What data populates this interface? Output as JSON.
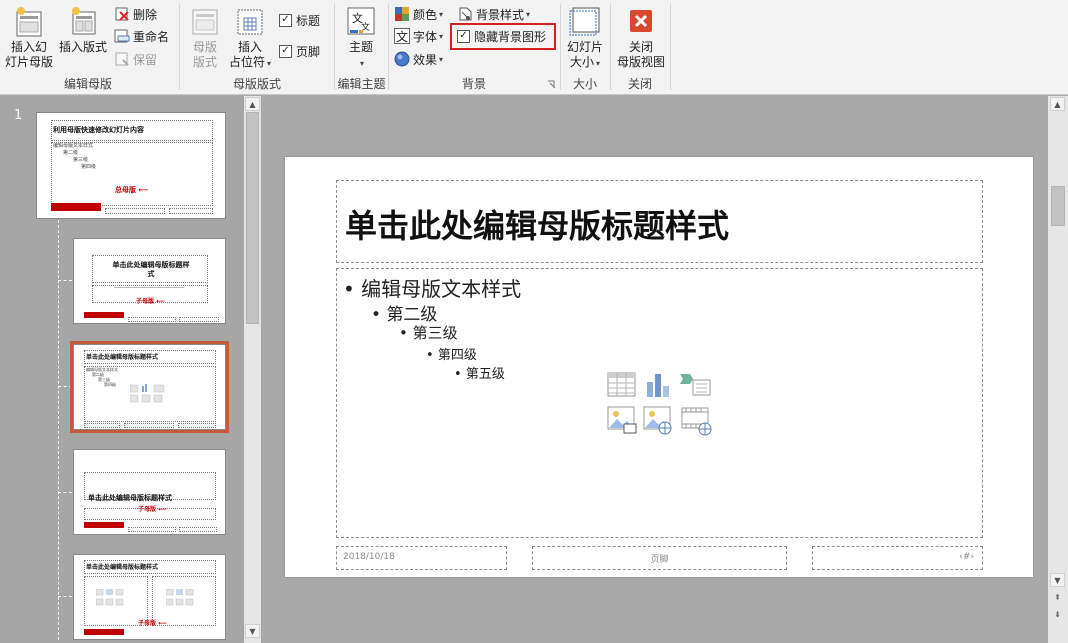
{
  "ribbon": {
    "groups": {
      "edit_master": {
        "label": "编辑母版",
        "insert_slide_master": "插入幻\n灯片母版",
        "insert_layout": "插入版式",
        "delete": "删除",
        "rename": "重命名",
        "preserve": "保留"
      },
      "master_layout": {
        "label": "母版版式",
        "master_layout_btn": "母版\n版式",
        "insert_placeholder": "插入\n占位符",
        "title_chk": "标题",
        "footer_chk": "页脚"
      },
      "edit_theme": {
        "label": "编辑主题",
        "themes": "主题"
      },
      "background": {
        "label": "背景",
        "colors": "颜色",
        "fonts": "字体",
        "effects": "效果",
        "background_styles": "背景样式",
        "hide_background_graphics": "隐藏背景图形"
      },
      "size": {
        "label": "大小",
        "slide_size": "幻灯片\n大小"
      },
      "close": {
        "label": "关闭",
        "close_master_view": "关闭\n母版视图"
      }
    }
  },
  "thumbnails": {
    "slide_number": "1",
    "master_title": "利用母版快速修改幻灯片内容",
    "master_body": [
      "编辑母版文本样式",
      "第二级",
      "第三级",
      "第四级",
      "第五级"
    ],
    "master_note": "总母版",
    "layout_title": "单击此处编辑母版标题样式",
    "layout_title_2": "单击此处编辑母版标题样",
    "layout_title_2b": "式",
    "sub_note": "子母版",
    "section_title": "单击此处编辑母版标题样式"
  },
  "slide": {
    "title": "单击此处编辑母版标题样式",
    "bullets": [
      "编辑母版文本样式",
      "第二级",
      "第三级",
      "第四级",
      "第五级"
    ],
    "footer_date": "2018/10/18",
    "footer_center": "页脚",
    "footer_number": "‹#›"
  }
}
